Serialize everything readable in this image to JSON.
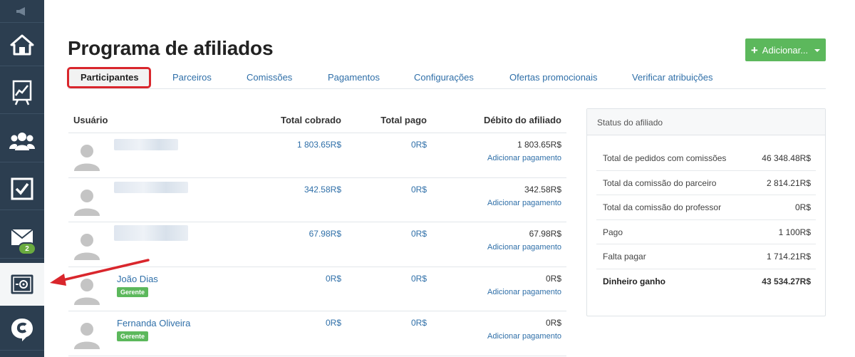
{
  "page": {
    "title": "Programa de afiliados",
    "add_button_label": "Adicionar..."
  },
  "sidebar": {
    "message_badge": "2"
  },
  "tabs": [
    {
      "label": "Participantes",
      "active": true
    },
    {
      "label": "Parceiros"
    },
    {
      "label": "Comissões"
    },
    {
      "label": "Pagamentos"
    },
    {
      "label": "Configurações"
    },
    {
      "label": "Ofertas promocionais"
    },
    {
      "label": "Verificar atribuições"
    }
  ],
  "table": {
    "headers": {
      "user": "Usuário",
      "total_charged": "Total cobrado",
      "total_paid": "Total pago",
      "debit": "Débito do afiliado"
    },
    "add_payment_label": "Adicionar pagamento",
    "rows": [
      {
        "name": "",
        "role": "",
        "total_charged": "1 803.65R$",
        "total_paid": "0R$",
        "debit": "1 803.65R$"
      },
      {
        "name": "",
        "role": "",
        "total_charged": "342.58R$",
        "total_paid": "0R$",
        "debit": "342.58R$"
      },
      {
        "name": "",
        "role": "",
        "total_charged": "67.98R$",
        "total_paid": "0R$",
        "debit": "67.98R$"
      },
      {
        "name": "João Dias",
        "role": "Gerente",
        "total_charged": "0R$",
        "total_paid": "0R$",
        "debit": "0R$"
      },
      {
        "name": "Fernanda Oliveira",
        "role": "Gerente",
        "total_charged": "0R$",
        "total_paid": "0R$",
        "debit": "0R$"
      }
    ]
  },
  "status_panel": {
    "title": "Status do afiliado",
    "rows": [
      {
        "label": "Total de pedidos com comissões",
        "value": "46 348.48R$"
      },
      {
        "label": "Total da comissão do parceiro",
        "value": "2 814.21R$"
      },
      {
        "label": "Total da comissão do professor",
        "value": "0R$"
      },
      {
        "label": "Pago",
        "value": "1 100R$"
      },
      {
        "label": "Falta pagar",
        "value": "1 714.21R$"
      },
      {
        "label": "Dinheiro ganho",
        "value": "43 534.27R$"
      }
    ]
  },
  "colors": {
    "sidebar": "#2c3e50",
    "link": "#2f6fa8",
    "accent_green": "#5cb85c",
    "highlight_red": "#d9262c"
  }
}
